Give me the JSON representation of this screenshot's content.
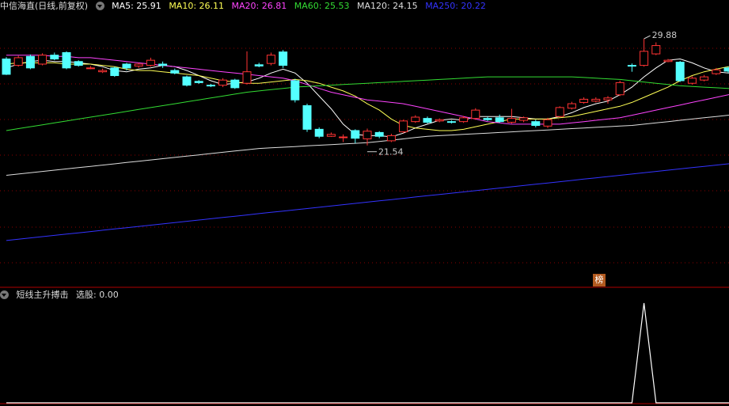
{
  "title": "中信海直(日线,前复权)",
  "ma": [
    {
      "label": "MA5: 25.91",
      "color": "#ffffff"
    },
    {
      "label": "MA10: 26.11",
      "color": "#ffff55"
    },
    {
      "label": "MA20: 26.81",
      "color": "#ff44ff"
    },
    {
      "label": "MA60: 25.53",
      "color": "#33dd33"
    },
    {
      "label": "MA120: 24.15",
      "color": "#dddddd"
    },
    {
      "label": "MA250: 20.22",
      "color": "#3333ff"
    }
  ],
  "indicator": {
    "name": "短线主升搏击",
    "value_label": "选股: 0.00"
  },
  "badge": "榜",
  "colors": {
    "up": "#ff3333",
    "down": "#54ffff",
    "grid": "#8b0000",
    "signal": "#ffffff"
  },
  "chart_data": {
    "type": "candlestick",
    "ylim": [
      10.5,
      31.8
    ],
    "annotations": [
      {
        "text": "29.88",
        "index": 53,
        "value": 29.88,
        "kind": "high"
      },
      {
        "text": "21.54",
        "index": 30,
        "value": 21.54,
        "kind": "low"
      }
    ],
    "candles": [
      [
        28.3,
        27.1,
        28.45,
        27.05
      ],
      [
        27.8,
        28.4,
        28.55,
        27.7
      ],
      [
        28.5,
        27.6,
        28.65,
        27.5
      ],
      [
        27.9,
        28.6,
        28.75,
        27.8
      ],
      [
        28.6,
        28.3,
        28.8,
        28.2
      ],
      [
        28.8,
        27.6,
        28.9,
        27.5
      ],
      [
        28.1,
        27.8,
        28.2,
        27.7
      ],
      [
        27.6,
        27.6,
        27.75,
        27.5
      ],
      [
        27.3,
        27.4,
        27.55,
        27.2
      ],
      [
        27.6,
        27.0,
        27.7,
        26.9
      ],
      [
        27.9,
        27.6,
        28.0,
        27.4
      ],
      [
        27.75,
        27.9,
        28.0,
        27.6
      ],
      [
        27.8,
        28.2,
        28.4,
        27.7
      ],
      [
        27.9,
        27.8,
        28.1,
        27.6
      ],
      [
        27.4,
        27.2,
        27.55,
        27.1
      ],
      [
        26.9,
        26.25,
        27.0,
        26.15
      ],
      [
        26.55,
        26.45,
        26.65,
        26.35
      ],
      [
        26.25,
        26.2,
        26.35,
        26.1
      ],
      [
        26.25,
        26.65,
        26.8,
        26.1
      ],
      [
        26.65,
        26.05,
        26.75,
        25.95
      ],
      [
        26.4,
        27.3,
        28.9,
        26.3
      ],
      [
        27.85,
        27.75,
        28.0,
        27.65
      ],
      [
        27.95,
        28.6,
        28.8,
        27.8
      ],
      [
        28.85,
        27.8,
        29.0,
        27.6
      ],
      [
        26.6,
        25.1,
        26.75,
        24.9
      ],
      [
        24.65,
        22.8,
        24.8,
        22.6
      ],
      [
        22.8,
        22.25,
        22.95,
        22.1
      ],
      [
        22.25,
        22.4,
        22.55,
        22.2
      ],
      [
        22.15,
        22.2,
        22.4,
        21.8
      ],
      [
        22.7,
        22.1,
        22.8,
        21.7
      ],
      [
        22.05,
        22.65,
        22.85,
        21.54
      ],
      [
        22.55,
        22.25,
        22.65,
        22.1
      ],
      [
        21.9,
        22.3,
        22.45,
        21.8
      ],
      [
        22.6,
        23.45,
        23.55,
        22.5
      ],
      [
        23.4,
        23.75,
        23.9,
        23.3
      ],
      [
        23.65,
        23.35,
        23.8,
        23.25
      ],
      [
        23.45,
        23.55,
        23.65,
        23.35
      ],
      [
        23.4,
        23.35,
        23.5,
        23.25
      ],
      [
        23.4,
        23.7,
        23.85,
        23.3
      ],
      [
        23.65,
        24.3,
        24.45,
        23.55
      ],
      [
        23.65,
        23.55,
        23.8,
        23.45
      ],
      [
        23.7,
        23.4,
        23.95,
        23.3
      ],
      [
        23.35,
        23.65,
        24.4,
        23.25
      ],
      [
        23.5,
        23.7,
        23.8,
        23.35
      ],
      [
        23.4,
        23.1,
        23.55,
        22.95
      ],
      [
        23.05,
        23.55,
        23.7,
        22.9
      ],
      [
        23.8,
        24.5,
        24.6,
        23.75
      ],
      [
        24.45,
        24.8,
        24.95,
        24.35
      ],
      [
        24.9,
        25.15,
        25.3,
        24.8
      ],
      [
        25.0,
        25.15,
        25.3,
        24.9
      ],
      [
        25.1,
        25.25,
        25.4,
        24.8
      ],
      [
        25.5,
        26.45,
        26.6,
        25.4
      ],
      [
        27.8,
        27.75,
        27.95,
        27.3
      ],
      [
        27.8,
        28.9,
        29.88,
        27.7
      ],
      [
        28.7,
        29.35,
        29.6,
        28.6
      ],
      [
        28.1,
        28.2,
        28.3,
        28.05
      ],
      [
        28.05,
        26.6,
        28.15,
        26.5
      ],
      [
        26.4,
        26.8,
        26.95,
        26.3
      ],
      [
        26.65,
        26.9,
        27.05,
        26.55
      ],
      [
        27.15,
        27.45,
        27.6,
        27.05
      ],
      [
        27.6,
        27.35,
        27.7,
        27.2
      ],
      [
        27.8,
        28.4,
        29.0,
        27.7
      ],
      [
        28.35,
        28.45,
        28.6,
        28.2
      ],
      [
        28.1,
        28.1,
        28.4,
        27.95
      ],
      [
        28.2,
        27.6,
        28.3,
        27.55
      ],
      [
        26.95,
        26.0,
        27.05,
        25.9
      ]
    ],
    "ma_series": [
      {
        "name": "MA5",
        "color": "#ffffff",
        "values": [
          27.6,
          27.9,
          28.1,
          28.2,
          28.1,
          28.1,
          28.0,
          27.9,
          27.7,
          27.4,
          27.3,
          27.5,
          27.6,
          27.8,
          27.7,
          27.4,
          27.0,
          26.6,
          26.3,
          26.4,
          26.5,
          26.8,
          27.2,
          27.5,
          27.2,
          26.4,
          25.4,
          24.4,
          23.2,
          22.4,
          22.3,
          22.3,
          22.2,
          22.5,
          22.9,
          23.2,
          23.5,
          23.6,
          23.5,
          23.8,
          23.8,
          23.8,
          23.8,
          23.7,
          23.6,
          23.6,
          23.8,
          24.1,
          24.5,
          24.8,
          25.0,
          25.5,
          26.1,
          26.9,
          27.6,
          28.2,
          28.3,
          28.0,
          27.6,
          27.3,
          27.2,
          27.3,
          27.6,
          27.8,
          27.8,
          27.5
        ]
      },
      {
        "name": "MA10",
        "color": "#ffff55",
        "values": [
          27.9,
          28.0,
          28.0,
          28.0,
          28.0,
          27.9,
          27.9,
          27.9,
          27.8,
          27.7,
          27.5,
          27.4,
          27.4,
          27.3,
          27.2,
          27.1,
          27.0,
          26.8,
          26.6,
          26.5,
          26.4,
          26.4,
          26.5,
          26.6,
          26.7,
          26.6,
          26.4,
          26.1,
          25.8,
          25.4,
          24.8,
          24.3,
          23.6,
          23.1,
          22.9,
          22.8,
          22.7,
          22.7,
          22.8,
          23.0,
          23.2,
          23.4,
          23.6,
          23.6,
          23.6,
          23.6,
          23.7,
          23.8,
          24.0,
          24.2,
          24.4,
          24.6,
          24.9,
          25.3,
          25.7,
          26.1,
          26.6,
          27.0,
          27.3,
          27.5,
          27.7,
          27.8,
          27.8,
          27.7,
          27.6,
          27.5
        ]
      },
      {
        "name": "MA20",
        "color": "#ff44ff",
        "values": [
          28.6,
          28.6,
          28.6,
          28.6,
          28.5,
          28.5,
          28.4,
          28.4,
          28.3,
          28.2,
          28.1,
          28.0,
          27.9,
          27.8,
          27.7,
          27.6,
          27.5,
          27.4,
          27.3,
          27.2,
          27.1,
          27.0,
          26.9,
          26.8,
          26.6,
          26.3,
          26.0,
          25.7,
          25.5,
          25.3,
          25.1,
          25.0,
          24.9,
          24.8,
          24.6,
          24.4,
          24.2,
          24.0,
          23.8,
          23.6,
          23.4,
          23.3,
          23.2,
          23.2,
          23.2,
          23.2,
          23.2,
          23.3,
          23.4,
          23.5,
          23.6,
          23.7,
          23.9,
          24.1,
          24.3,
          24.5,
          24.7,
          24.9,
          25.1,
          25.3,
          25.5,
          25.7,
          25.9,
          26.1,
          26.3,
          26.4
        ]
      },
      {
        "name": "MA60",
        "color": "#33dd33",
        "values": [
          22.7,
          22.85,
          23.0,
          23.15,
          23.3,
          23.45,
          23.6,
          23.75,
          23.9,
          24.05,
          24.2,
          24.35,
          24.5,
          24.65,
          24.8,
          24.95,
          25.1,
          25.25,
          25.4,
          25.55,
          25.7,
          25.8,
          25.9,
          26.0,
          26.1,
          26.15,
          26.2,
          26.25,
          26.3,
          26.35,
          26.4,
          26.45,
          26.5,
          26.55,
          26.6,
          26.65,
          26.7,
          26.75,
          26.8,
          26.85,
          26.9,
          26.9,
          26.9,
          26.9,
          26.9,
          26.9,
          26.9,
          26.9,
          26.85,
          26.8,
          26.75,
          26.7,
          26.6,
          26.5,
          26.4,
          26.3,
          26.2,
          26.15,
          26.1,
          26.05,
          26.0,
          25.95,
          25.9,
          25.85,
          25.8,
          25.78
        ]
      },
      {
        "name": "MA120",
        "color": "#dddddd",
        "values": [
          19.2,
          19.3,
          19.4,
          19.5,
          19.6,
          19.7,
          19.8,
          19.9,
          20.0,
          20.1,
          20.2,
          20.3,
          20.4,
          20.5,
          20.6,
          20.7,
          20.8,
          20.9,
          21.0,
          21.1,
          21.2,
          21.3,
          21.35,
          21.4,
          21.45,
          21.5,
          21.55,
          21.6,
          21.65,
          21.7,
          21.75,
          21.85,
          21.95,
          22.05,
          22.15,
          22.25,
          22.3,
          22.35,
          22.4,
          22.45,
          22.5,
          22.55,
          22.6,
          22.65,
          22.7,
          22.75,
          22.8,
          22.85,
          22.9,
          22.95,
          23.0,
          23.05,
          23.1,
          23.2,
          23.3,
          23.4,
          23.5,
          23.6,
          23.7,
          23.8,
          23.9,
          24.0,
          24.1,
          24.2,
          24.3,
          24.4
        ]
      },
      {
        "name": "MA250",
        "color": "#3333ff",
        "values": [
          14.1,
          14.2,
          14.3,
          14.4,
          14.5,
          14.6,
          14.7,
          14.8,
          14.9,
          15.0,
          15.1,
          15.2,
          15.3,
          15.4,
          15.5,
          15.6,
          15.7,
          15.8,
          15.9,
          16.0,
          16.1,
          16.2,
          16.3,
          16.4,
          16.5,
          16.6,
          16.7,
          16.8,
          16.9,
          17.0,
          17.1,
          17.2,
          17.3,
          17.4,
          17.5,
          17.6,
          17.7,
          17.8,
          17.9,
          18.0,
          18.1,
          18.2,
          18.3,
          18.4,
          18.5,
          18.6,
          18.7,
          18.8,
          18.9,
          19.0,
          19.1,
          19.2,
          19.3,
          19.4,
          19.5,
          19.6,
          19.7,
          19.8,
          19.9,
          20.0,
          20.1,
          20.2,
          20.3,
          20.4,
          20.5,
          20.6
        ]
      }
    ],
    "indicator_series": {
      "name": "选股",
      "values": [
        0,
        0,
        0,
        0,
        0,
        0,
        0,
        0,
        0,
        0,
        0,
        0,
        0,
        0,
        0,
        0,
        0,
        0,
        0,
        0,
        0,
        0,
        0,
        0,
        0,
        0,
        0,
        0,
        0,
        0,
        0,
        0,
        0,
        0,
        0,
        0,
        0,
        0,
        0,
        0,
        0,
        0,
        0,
        0,
        0,
        0,
        0,
        0,
        0,
        0,
        0,
        0,
        0,
        1,
        0,
        0,
        0,
        0,
        0,
        0,
        0,
        0,
        0,
        0,
        0,
        0
      ]
    }
  }
}
